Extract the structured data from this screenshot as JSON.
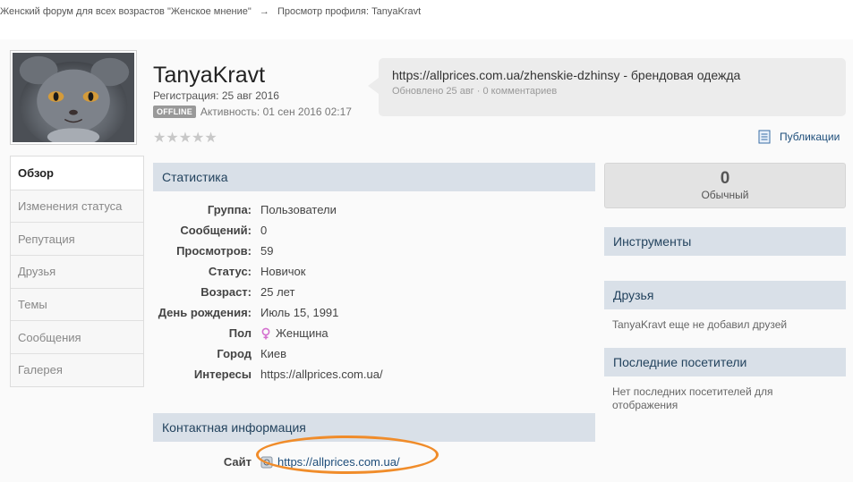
{
  "breadcrumb": {
    "forum": "Женский форум для всех возрастов \"Женское мнение\"",
    "separator": "→",
    "current": "Просмотр профиля: TanyaKravt"
  },
  "profile": {
    "username": "TanyaKravt",
    "registration": "Регистрация: 25 авг 2016",
    "badge": "OFFLINE",
    "activity": "Активность: 01 сен 2016 02:17",
    "rating_stars": "★★★★★",
    "rating_value": 0
  },
  "status_update": {
    "text": "https://allprices.com.ua/zhenskie-dzhinsy - брендовая одежда",
    "meta": "Обновлено 25 авг · 0 комментариев"
  },
  "publications_label": "Публикации",
  "tabs": [
    {
      "label": "Обзор",
      "active": true
    },
    {
      "label": "Изменения статуса",
      "active": false
    },
    {
      "label": "Репутация",
      "active": false
    },
    {
      "label": "Друзья",
      "active": false
    },
    {
      "label": "Темы",
      "active": false
    },
    {
      "label": "Сообщения",
      "active": false
    },
    {
      "label": "Галерея",
      "active": false
    }
  ],
  "stats": {
    "title": "Статистика",
    "rows": [
      {
        "key": "Группа:",
        "value": "Пользователи"
      },
      {
        "key": "Сообщений:",
        "value": "0"
      },
      {
        "key": "Просмотров:",
        "value": "59"
      },
      {
        "key": "Статус:",
        "value": "Новичок"
      },
      {
        "key": "Возраст:",
        "value": "25 лет"
      },
      {
        "key": "День рождения:",
        "value": "Июль 15, 1991"
      },
      {
        "key": "Пол",
        "value": "Женщина"
      },
      {
        "key": "Город",
        "value": "Киев"
      },
      {
        "key": "Интересы",
        "value": "https://allprices.com.ua/"
      }
    ]
  },
  "contact": {
    "title": "Контактная информация",
    "site_key": "Сайт",
    "site_value": "https://allprices.com.ua/"
  },
  "reputation": {
    "value": "0",
    "label": "Обычный"
  },
  "sidebar": {
    "tools_title": "Инструменты",
    "friends_title": "Друзья",
    "friends_text": "TanyaKravt еще не добавил друзей",
    "visitors_title": "Последние посетители",
    "visitors_text": "Нет последних посетителей для отображения"
  },
  "colors": {
    "header_bg": "#d9e0e8",
    "header_text": "#23435e",
    "link": "#1d4d7a",
    "highlight_oval": "#f08c2a",
    "gender_icon": "#d46fcf"
  },
  "icons": {
    "gender": "female-icon",
    "site": "website-icon",
    "publications": "document-icon"
  }
}
